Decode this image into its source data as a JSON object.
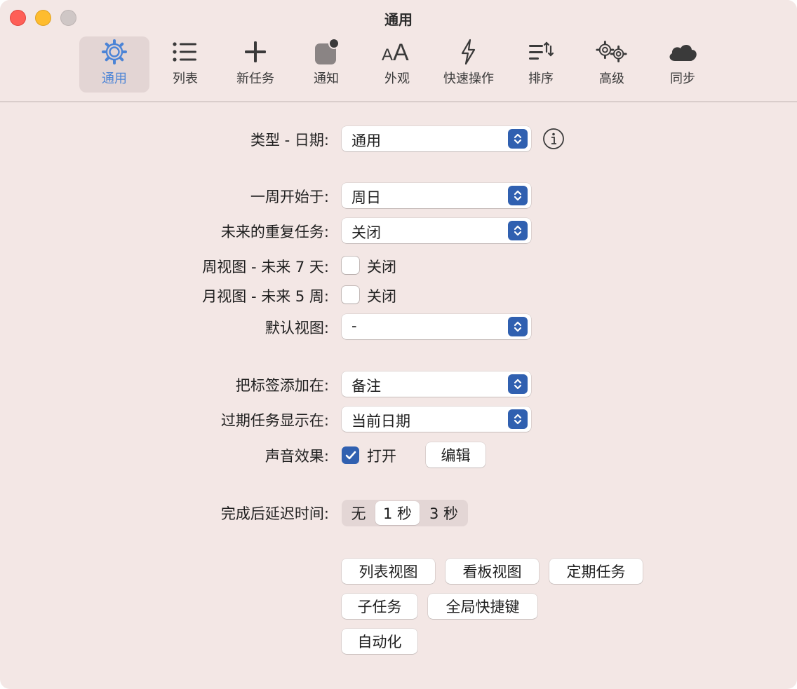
{
  "window": {
    "title": "通用"
  },
  "toolbar": {
    "items": [
      {
        "label": "通用",
        "icon": "gear-icon",
        "active": true
      },
      {
        "label": "列表",
        "icon": "list-icon"
      },
      {
        "label": "新任务",
        "icon": "plus-icon"
      },
      {
        "label": "通知",
        "icon": "notification-badge-icon"
      },
      {
        "label": "外观",
        "icon": "text-size-icon"
      },
      {
        "label": "快速操作",
        "icon": "bolt-icon"
      },
      {
        "label": "排序",
        "icon": "sort-icon"
      },
      {
        "label": "高级",
        "icon": "gears-icon"
      },
      {
        "label": "同步",
        "icon": "cloud-icon"
      }
    ]
  },
  "settings": {
    "type_date": {
      "label": "类型 - 日期:",
      "value": "通用"
    },
    "week_start": {
      "label": "一周开始于:",
      "value": "周日"
    },
    "future_repeat": {
      "label": "未来的重复任务:",
      "value": "关闭"
    },
    "week_view": {
      "label": "周视图 - 未来 7 天:",
      "value": "关闭",
      "checked": false
    },
    "month_view": {
      "label": "月视图 - 未来 5 周:",
      "value": "关闭",
      "checked": false
    },
    "default_view": {
      "label": "默认视图:",
      "value": "-"
    },
    "add_tags": {
      "label": "把标签添加在:",
      "value": "备注"
    },
    "overdue": {
      "label": "过期任务显示在:",
      "value": "当前日期"
    },
    "sound": {
      "label": "声音效果:",
      "value": "打开",
      "checked": true,
      "edit_label": "编辑"
    },
    "delay": {
      "label": "完成后延迟时间:",
      "options": [
        "无",
        "1 秒",
        "3 秒"
      ],
      "selected": "1 秒"
    }
  },
  "buttons": {
    "list_view": "列表视图",
    "kanban_view": "看板视图",
    "recurring": "定期任务",
    "subtasks": "子任务",
    "global_shortcut": "全局快捷键",
    "automation": "自动化"
  },
  "colors": {
    "accent": "#3060b0",
    "active_tab_label": "#4c84d6",
    "background": "#f3e7e5"
  }
}
